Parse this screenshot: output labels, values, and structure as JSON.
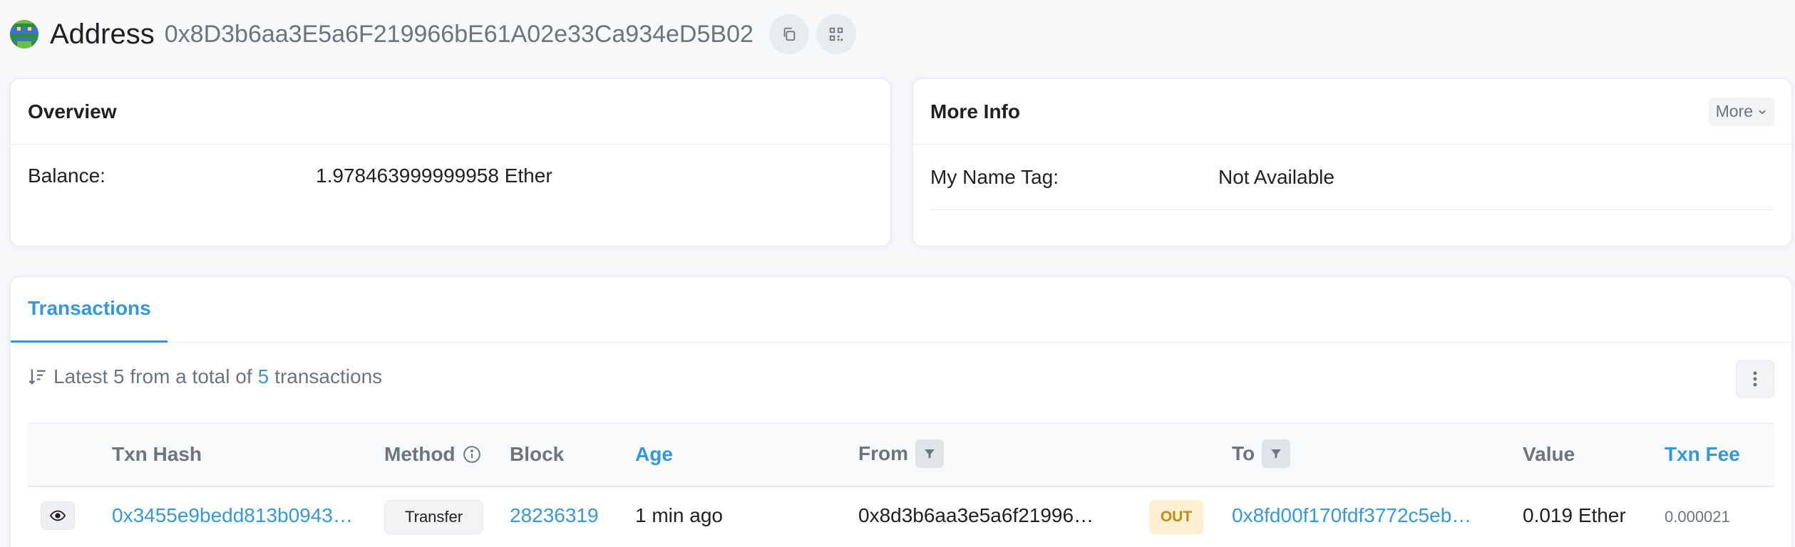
{
  "header": {
    "title": "Address",
    "address": "0x8D3b6aa3E5a6F219966bE61A02e33Ca934eD5B02",
    "copy_icon": "copy-icon",
    "qr_icon": "qr-code-icon"
  },
  "overview": {
    "title": "Overview",
    "balance_label": "Balance:",
    "balance_value": "1.978463999999958 Ether"
  },
  "more_info": {
    "title": "More Info",
    "more_button": "More",
    "name_tag_label": "My Name Tag:",
    "name_tag_value": "Not Available"
  },
  "transactions": {
    "tab_label": "Transactions",
    "summary_prefix": "Latest 5 from a total of",
    "summary_count": "5",
    "summary_suffix": "transactions",
    "columns": {
      "txn_hash": "Txn Hash",
      "method": "Method",
      "block": "Block",
      "age": "Age",
      "from": "From",
      "to": "To",
      "value": "Value",
      "txn_fee": "Txn Fee"
    },
    "rows": [
      {
        "txn_hash": "0x3455e9bedd813b0943…",
        "method": "Transfer",
        "block": "28236319",
        "age": "1 min ago",
        "from": "0x8d3b6aa3e5a6f21996…",
        "direction": "OUT",
        "to": "0x8fd00f170fdf3772c5eb…",
        "value": "0.019 Ether",
        "txn_fee": "0.000021"
      }
    ]
  },
  "colors": {
    "link": "#3498db",
    "out_badge_bg": "#fcefd2",
    "out_badge_text": "#c28b0d"
  }
}
